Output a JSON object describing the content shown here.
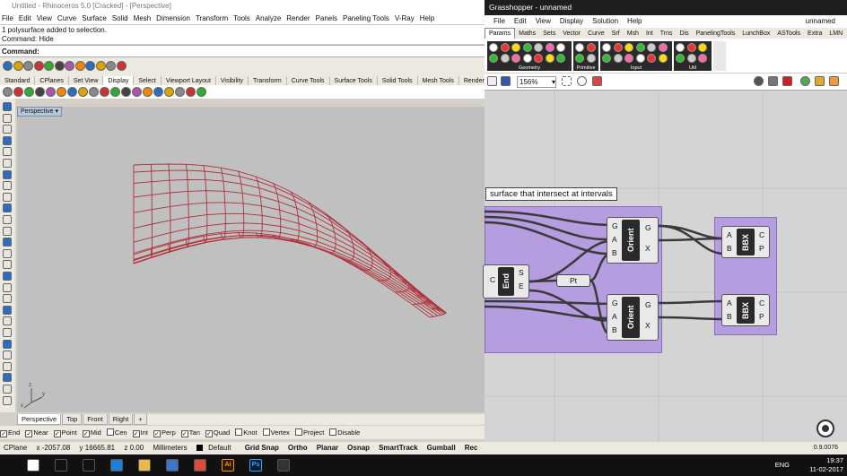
{
  "rhino": {
    "title": "Untitled - Rhinoceros 5.0 [Cracked] - [Perspective]",
    "menu": [
      "File",
      "Edit",
      "View",
      "Curve",
      "Surface",
      "Solid",
      "Mesh",
      "Dimension",
      "Transform",
      "Tools",
      "Analyze",
      "Render",
      "Panels",
      "Paneling Tools",
      "V-Ray",
      "Help"
    ],
    "command_history": [
      "1 polysurface added to selection.",
      "Command: Hide"
    ],
    "command_prompt": "Command:",
    "toolbar_tabs": [
      "Standard",
      "CPlanes",
      "Set View",
      "Display",
      "Select",
      "Viewport Layout",
      "Visibility",
      "Transform",
      "Curve Tools",
      "Surface Tools",
      "Solid Tools",
      "Mesh Tools",
      "Render Tools"
    ],
    "active_toolbar_tab": "Display",
    "viewport_label": "Perspective",
    "viewport_tabs": [
      "Perspective",
      "Top",
      "Front",
      "Right",
      "+"
    ],
    "osnaps": [
      {
        "label": "End",
        "checked": true
      },
      {
        "label": "Near",
        "checked": true
      },
      {
        "label": "Point",
        "checked": true
      },
      {
        "label": "Mid",
        "checked": true
      },
      {
        "label": "Cen",
        "checked": false
      },
      {
        "label": "Int",
        "checked": true
      },
      {
        "label": "Perp",
        "checked": true
      },
      {
        "label": "Tan",
        "checked": true
      },
      {
        "label": "Quad",
        "checked": true
      },
      {
        "label": "Knot",
        "checked": false
      },
      {
        "label": "Vertex",
        "checked": false
      },
      {
        "label": "Project",
        "checked": false
      },
      {
        "label": "Disable",
        "checked": false
      }
    ],
    "status": {
      "cplane": "CPlane",
      "x": "x -2057.08",
      "y": "y 16665.81",
      "z": "z 0.00",
      "units": "Millimeters",
      "layer": "Default",
      "modes": [
        "Grid Snap",
        "Ortho",
        "Planar",
        "Osnap",
        "SmartTrack",
        "Gumball",
        "Rec"
      ]
    },
    "colors": {
      "wireframe": "#b0303a",
      "viewport_bg": "#c0c0c0"
    }
  },
  "gh": {
    "title": "Grasshopper - unnamed",
    "menu": [
      "File",
      "Edit",
      "View",
      "Display",
      "Solution",
      "Help"
    ],
    "doc_name": "unnamed",
    "tabs": [
      "Params",
      "Maths",
      "Sets",
      "Vector",
      "Curve",
      "Srf",
      "Msh",
      "Int",
      "Trns",
      "Dis",
      "PanelingTools",
      "LunchBox",
      "ASTools",
      "Extra",
      "LMN"
    ],
    "active_tab": "Params",
    "ribbon_groups": [
      "Geometry",
      "Primitive",
      "Input",
      "Util"
    ],
    "zoom": "156%",
    "note": "surface that intersect at intervals",
    "components": {
      "end": {
        "name": "End",
        "inputs": [
          "C"
        ],
        "outputs": [
          "S",
          "E"
        ]
      },
      "pt": {
        "name": "Pt"
      },
      "orient1": {
        "name": "Orient",
        "inputs": [
          "G",
          "A",
          "B"
        ],
        "outputs": [
          "G",
          "X"
        ]
      },
      "orient2": {
        "name": "Orient",
        "inputs": [
          "G",
          "A",
          "B"
        ],
        "outputs": [
          "G",
          "X"
        ]
      },
      "bbx1": {
        "name": "BBX",
        "inputs": [
          "A",
          "B"
        ],
        "outputs": [
          "C",
          "P"
        ]
      },
      "bbx2": {
        "name": "BBX",
        "inputs": [
          "A",
          "B"
        ],
        "outputs": [
          "C",
          "P"
        ]
      }
    },
    "status": "0.9.0076",
    "colors": {
      "group": "#b59de0",
      "canvas": "#d4d4d4",
      "component_core": "#2a2a2a"
    }
  },
  "taskbar": {
    "apps": [
      "windows-logo",
      "search",
      "task-view",
      "edge",
      "file-explorer",
      "store",
      "chrome",
      "illustrator",
      "photoshop",
      "rhino"
    ],
    "ai_label": "Ai",
    "ps_label": "Ps",
    "lang": "ENG",
    "time": "19:37",
    "date": "11-02-2017"
  }
}
